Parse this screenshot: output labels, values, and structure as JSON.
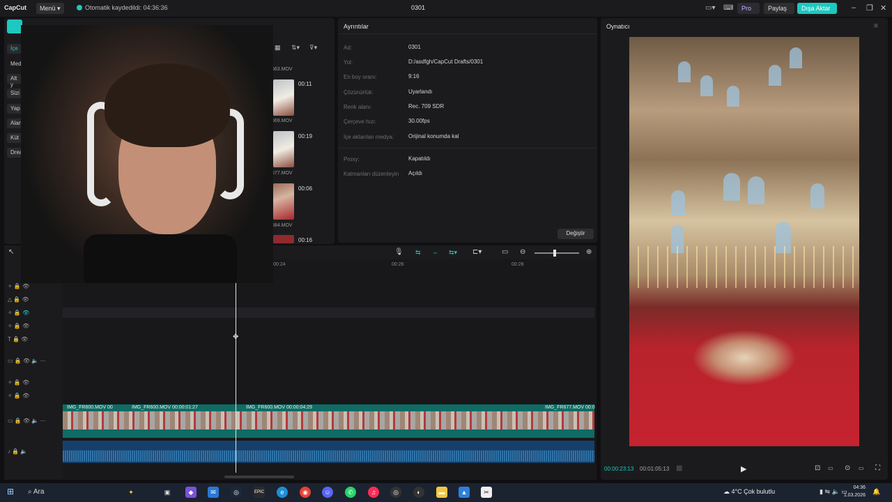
{
  "app": {
    "logo": "CapCut",
    "menu_label": "Menü",
    "autosave_text": "Otomatik kaydedildi: 04:36:36",
    "project_title": "0301",
    "pro_label": "Pro",
    "share_label": "Paylaş",
    "export_label": "Dışa Aktar",
    "accent": "#1ec8c0"
  },
  "media": {
    "sidebar_items": [
      "İçe",
      "Med",
      "Alt y",
      "Sizi",
      "Yap",
      "Alan",
      "Küt",
      "Drea"
    ],
    "clips": [
      {
        "name": "663.MOV",
        "duration": ""
      },
      {
        "name": "669.MOV",
        "duration": "00:11"
      },
      {
        "name": "677.MOV",
        "duration": "00:19"
      },
      {
        "name": "684.MOV",
        "duration": "00:06"
      },
      {
        "name": "",
        "duration": "00:16"
      }
    ]
  },
  "details": {
    "title": "Ayrıntılar",
    "rows": [
      {
        "label": "Ad:",
        "value": "0301"
      },
      {
        "label": "Yol:",
        "value": "D:/asdfgh/CapCut Drafts/0301"
      },
      {
        "label": "En boy oranı:",
        "value": "9:16"
      },
      {
        "label": "Çözünürlük:",
        "value": "Uyarlandı"
      },
      {
        "label": "Renk alanı:",
        "value": "Rec. 709 SDR"
      },
      {
        "label": "Çerçeve hızı:",
        "value": "30.00fps"
      },
      {
        "label": "İçe aktarılan medya:",
        "value": "Orijinal konumda kal"
      },
      {
        "label": "Proxy:",
        "value": "Kapatıldı"
      },
      {
        "label": "Katmanları düzenleyin",
        "value": "Açıldı"
      }
    ],
    "change_label": "Değiştir"
  },
  "player": {
    "title": "Oynatıcı",
    "current_time": "00:00:23:13",
    "total_time": "00:01:05:13"
  },
  "timeline": {
    "ruler": [
      "00:24",
      "00:26",
      "00:28"
    ],
    "clips": [
      {
        "label": "IMG_FR600.MOV  00"
      },
      {
        "label": "IMG_FR600.MOV  00:00:01:27"
      },
      {
        "label": "IMG_FR600.MOV  00:00:04:29"
      },
      {
        "label": "IMG_FR677.MOV  00:0"
      }
    ]
  },
  "taskbar": {
    "search_placeholder": "Ara",
    "weather": "4°C  Çok bulutlu",
    "time": "04:36",
    "date": "1.03.2026"
  }
}
